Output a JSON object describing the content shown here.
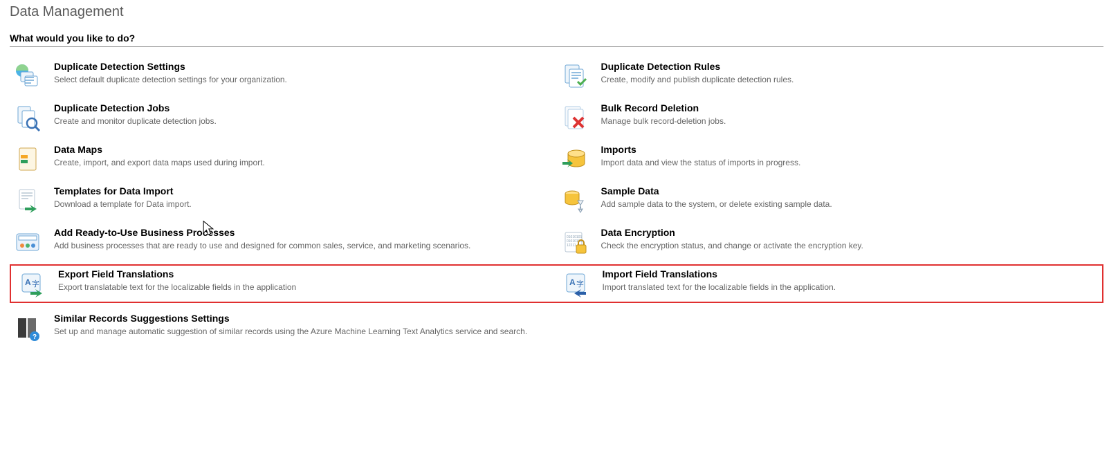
{
  "page_title": "Data Management",
  "section_heading": "What would you like to do?",
  "items": {
    "dup_settings": {
      "title": "Duplicate Detection Settings",
      "desc": "Select default duplicate detection settings for your organization."
    },
    "dup_rules": {
      "title": "Duplicate Detection Rules",
      "desc": "Create, modify and publish duplicate detection rules."
    },
    "dup_jobs": {
      "title": "Duplicate Detection Jobs",
      "desc": "Create and monitor duplicate detection jobs."
    },
    "bulk_delete": {
      "title": "Bulk Record Deletion",
      "desc": "Manage bulk record-deletion jobs."
    },
    "data_maps": {
      "title": "Data Maps",
      "desc": "Create, import, and export data maps used during import."
    },
    "imports": {
      "title": "Imports",
      "desc": "Import data and view the status of imports in progress."
    },
    "templates": {
      "title": "Templates for Data Import",
      "desc": "Download a template for Data import."
    },
    "sample_data": {
      "title": "Sample Data",
      "desc": "Add sample data to the system, or delete existing sample data."
    },
    "biz_proc": {
      "title": "Add Ready-to-Use Business Processes",
      "desc": "Add business processes that are ready to use and designed for common sales, service, and marketing scenarios."
    },
    "encryption": {
      "title": "Data Encryption",
      "desc": "Check the encryption status, and change or activate the encryption key."
    },
    "export_trans": {
      "title": "Export Field Translations",
      "desc": "Export translatable text for the localizable fields in the application"
    },
    "import_trans": {
      "title": "Import Field Translations",
      "desc": "Import translated text for the localizable fields in the application."
    },
    "similar_rec": {
      "title": "Similar Records Suggestions Settings",
      "desc": "Set up and manage automatic suggestion of similar records using the Azure Machine Learning Text Analytics service and search."
    }
  }
}
